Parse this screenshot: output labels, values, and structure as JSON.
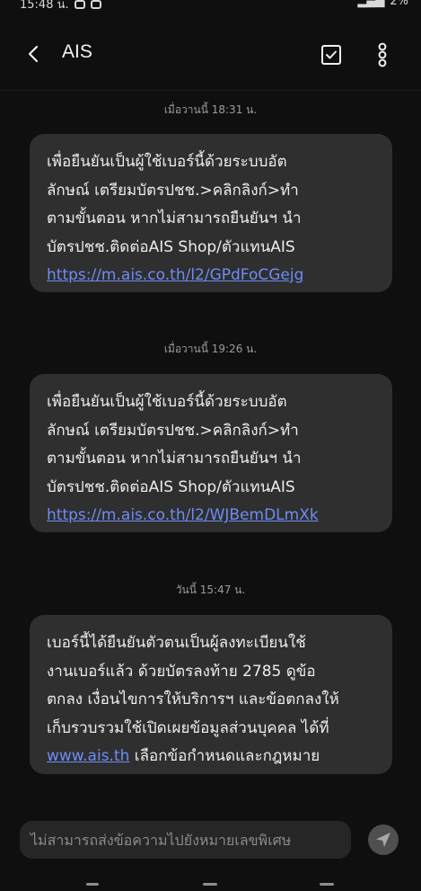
{
  "status_bar": {
    "time": "15:48 น.",
    "battery": "2%"
  },
  "header": {
    "title": "AIS"
  },
  "messages": [
    {
      "timestamp": "เมื่อวานนี้ 18:31 น.",
      "lines": [
        "เพื่อยืนยันเป็นผู้ใช้เบอร์นี้ด้วยระบบอัต",
        "ลักษณ์ เตรียมบัตรปชช.>คลิกลิงก์>ทำ",
        "ตามขั้นตอน หากไม่สามารถยืนยันฯ นำ",
        "บัตรปชช.ติดต่อAIS Shop/ตัวแทนAIS"
      ],
      "link": "https://m.ais.co.th/l2/GPdFoCGejg"
    },
    {
      "timestamp": "เมื่อวานนี้ 19:26 น.",
      "lines": [
        "เพื่อยืนยันเป็นผู้ใช้เบอร์นี้ด้วยระบบอัต",
        "ลักษณ์ เตรียมบัตรปชช.>คลิกลิงก์>ทำ",
        "ตามขั้นตอน หากไม่สามารถยืนยันฯ นำ",
        "บัตรปชช.ติดต่อAIS Shop/ตัวแทนAIS"
      ],
      "link": "https://m.ais.co.th/l2/WJBemDLmXk"
    },
    {
      "timestamp": "วันนี้ 15:47 น.",
      "lines": [
        "เบอร์นี้ได้ยืนยันตัวตนเป็นผู้ลงทะเบียนใช้",
        "งานเบอร์แล้ว ด้วยบัตรลงท้าย 2785 ดูข้อ",
        "ตกลง เงื่อนไขการให้บริการฯ และข้อตกลงให้",
        "เก็บรวบรวมใช้เปิดเผยข้อมูลส่วนบุคคล ได้ที่"
      ],
      "link": "www.ais.th",
      "after_link": " เลือกข้อกำหนดและกฎหมาย"
    }
  ],
  "composer": {
    "placeholder": "ไม่สามารถส่งข้อความไปยังหมายเลขพิเศษ"
  },
  "icons": {
    "back": "arrow-left-icon",
    "select": "checkbox-icon",
    "more": "more-vertical-icon",
    "send": "send-icon"
  },
  "colors": {
    "link": "#6e8cf5",
    "bubble": "#2f2f2f",
    "background": "#0f0f0f"
  }
}
